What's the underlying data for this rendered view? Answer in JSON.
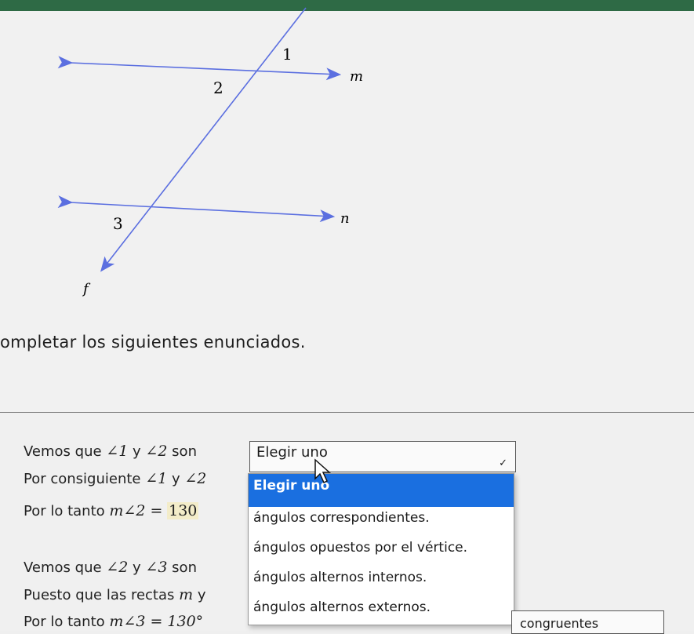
{
  "figure": {
    "labels": {
      "angle1": "1",
      "angle2": "2",
      "angle3": "3",
      "line_m": "m",
      "line_n": "n",
      "line_f": "f"
    }
  },
  "instruction": "ompletar los siguientes enunciados.",
  "statements": {
    "s1_prefix": "Vemos que",
    "s1_angle1": "∠1",
    "s1_y": "y",
    "s1_angle2": "∠2",
    "s1_son": "son",
    "s2_prefix": "Por consiguiente",
    "s2_angle1": "∠1",
    "s2_y": "y",
    "s2_angle2": "∠2",
    "s3_prefix": "Por lo tanto",
    "s3_expr": "m∠2 =",
    "s3_value": "130",
    "s4_prefix": "Vemos que",
    "s4_angle2": "∠2",
    "s4_y": "y",
    "s4_angle3": "∠3",
    "s4_son": "son",
    "s5_prefix": "Puesto que las rectas",
    "s5_m": "m",
    "s5_y": "y",
    "s6_prefix": "Por lo tanto",
    "s6_expr": "m∠3 = 130°"
  },
  "select1": {
    "value": "Elegir uno"
  },
  "dropdown": {
    "options": [
      "Elegir uno",
      "ángulos correspondientes.",
      "ángulos opuestos por el vértice.",
      "ángulos alternos internos.",
      "ángulos alternos externos."
    ],
    "selected_index": 0
  },
  "select_bottom": {
    "value": "congruentes"
  },
  "colors": {
    "figure_line": "#5b6fe0",
    "dropdown_highlight": "#1a6fe0",
    "top_bar": "#2e6a45",
    "answer_highlight": "#f3ecc9"
  }
}
